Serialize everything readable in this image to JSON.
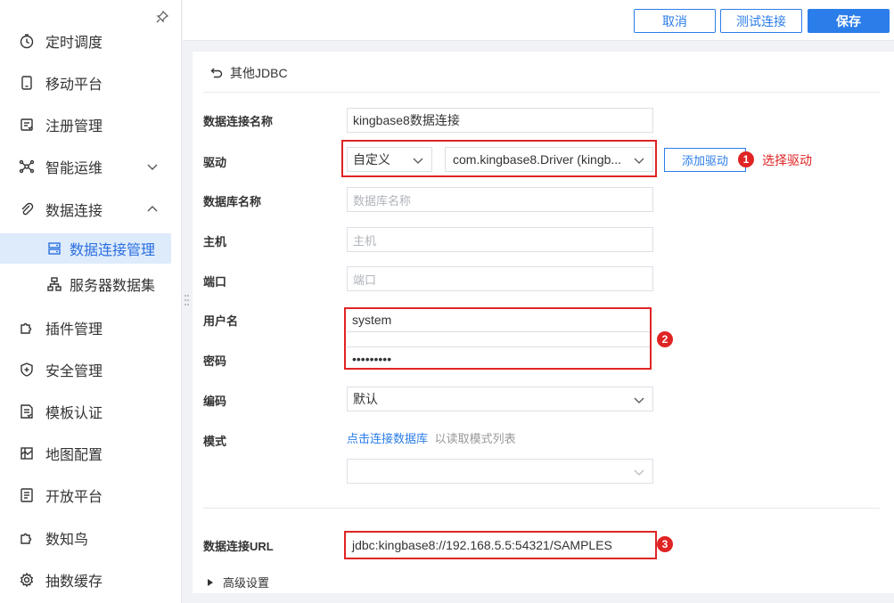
{
  "sidebar": {
    "items": [
      {
        "label": "定时调度",
        "icon": "clock-icon"
      },
      {
        "label": "移动平台",
        "icon": "mobile-icon"
      },
      {
        "label": "注册管理",
        "icon": "register-icon"
      },
      {
        "label": "智能运维",
        "icon": "ops-icon"
      },
      {
        "label": "数据连接",
        "icon": "link-icon"
      },
      {
        "label": "插件管理",
        "icon": "plugin-icon"
      },
      {
        "label": "安全管理",
        "icon": "shield-icon"
      },
      {
        "label": "模板认证",
        "icon": "template-icon"
      },
      {
        "label": "地图配置",
        "icon": "map-icon"
      },
      {
        "label": "开放平台",
        "icon": "open-platform-icon"
      },
      {
        "label": "数知鸟",
        "icon": "bird-icon"
      },
      {
        "label": "抽数缓存",
        "icon": "cache-icon"
      }
    ],
    "sub_items": [
      {
        "label": "数据连接管理",
        "icon": "database-icon",
        "active": true
      },
      {
        "label": "服务器数据集",
        "icon": "server-dataset-icon",
        "active": false
      }
    ]
  },
  "toolbar": {
    "cancel_label": "取消",
    "test_label": "测试连接",
    "save_label": "保存"
  },
  "form": {
    "back_label": "其他JDBC",
    "conn_name_label": "数据连接名称",
    "conn_name_value": "kingbase8数据连接",
    "driver_label": "驱动",
    "driver_mode_value": "自定义",
    "driver_class_value": "com.kingbase8.Driver (kingb...",
    "add_driver_label": "添加驱动",
    "db_name_label": "数据库名称",
    "db_name_placeholder": "数据库名称",
    "host_label": "主机",
    "host_placeholder": "主机",
    "port_label": "端口",
    "port_placeholder": "端口",
    "username_label": "用户名",
    "username_value": "system",
    "password_label": "密码",
    "password_value": "•••••••••",
    "encoding_label": "编码",
    "encoding_value": "默认",
    "schema_label": "模式",
    "schema_link": "点击连接数据库",
    "schema_hint": "以读取模式列表",
    "url_label": "数据连接URL",
    "url_value": "jdbc:kingbase8://192.168.5.5:54321/SAMPLES",
    "advanced_label": "高级设置"
  },
  "annotations": {
    "badge1": "1",
    "badge1_text": "选择驱动",
    "badge2": "2",
    "badge3": "3"
  },
  "colors": {
    "accent": "#2b7de9",
    "annotation": "#e02424",
    "active_bg": "#ddebfb"
  }
}
